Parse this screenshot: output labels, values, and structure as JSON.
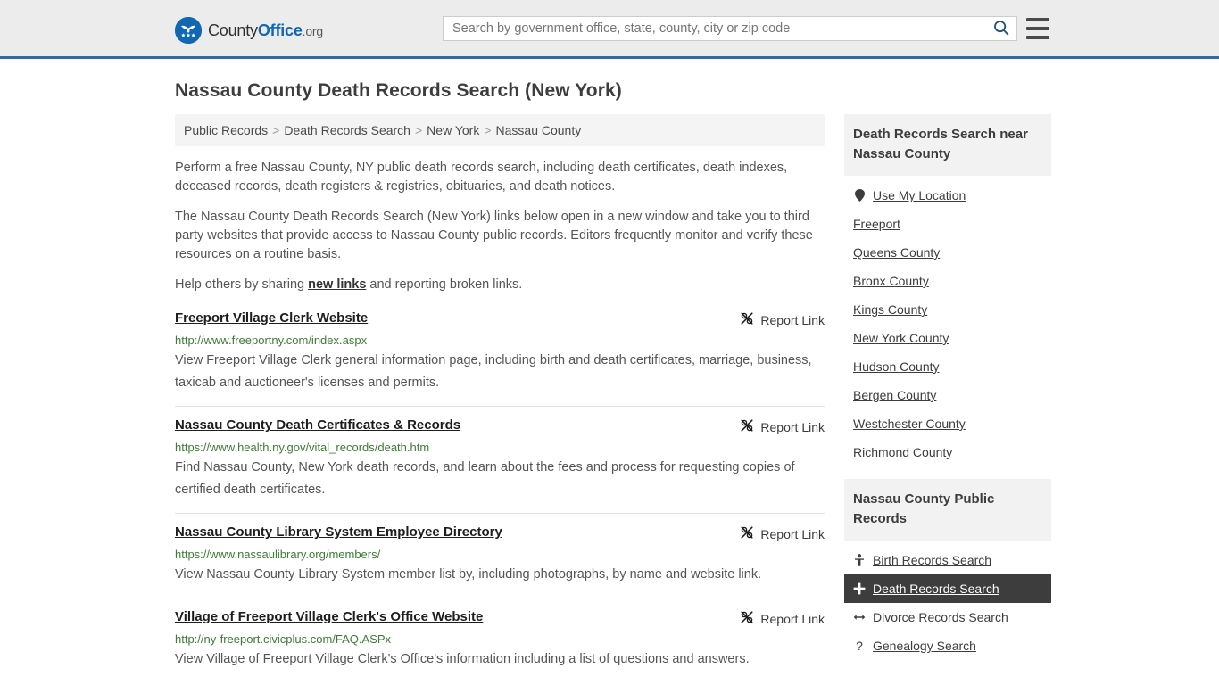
{
  "header": {
    "brand": {
      "logo_icon": "eagle-seal-icon",
      "name_part1": "County",
      "name_part2": "Office",
      "name_part3": ".org"
    },
    "search": {
      "placeholder": "Search by government office, state, county, city or zip code",
      "value": "",
      "search_icon": "search-icon"
    },
    "menu_icon": "hamburger-menu-icon",
    "accent_color": "#35689e"
  },
  "page": {
    "title": "Nassau County Death Records Search (New York)"
  },
  "breadcrumb": {
    "separator": ">",
    "items": [
      {
        "label": "Public Records"
      },
      {
        "label": "Death Records Search"
      },
      {
        "label": "New York"
      },
      {
        "label": "Nassau County"
      }
    ]
  },
  "intro": {
    "paragraph1": "Perform a free Nassau County, NY public death records search, including death certificates, death indexes, deceased records, death registers & registries, obituaries, and death notices.",
    "paragraph2": "The Nassau County Death Records Search (New York) links below open in a new window and take you to third party websites that provide access to Nassau County public records. Editors frequently monitor and verify these resources on a routine basis.",
    "paragraph3_before": "Help others by sharing ",
    "paragraph3_link": "new links",
    "paragraph3_after": " and reporting broken links."
  },
  "results": {
    "report_label": "Report Link",
    "report_icon": "broken-link-icon",
    "items": [
      {
        "title": "Freeport Village Clerk Website",
        "url": "http://www.freeportny.com/index.aspx",
        "description": "View Freeport Village Clerk general information page, including birth and death certificates, marriage, business, taxicab and auctioneer's licenses and permits."
      },
      {
        "title": "Nassau County Death Certificates & Records",
        "url": "https://www.health.ny.gov/vital_records/death.htm",
        "description": "Find Nassau County, New York death records, and learn about the fees and process for requesting copies of certified death certificates."
      },
      {
        "title": "Nassau County Library System Employee Directory",
        "url": "https://www.nassaulibrary.org/members/",
        "description": "View Nassau County Library System member list by, including photographs, by name and website link."
      },
      {
        "title": "Village of Freeport Village Clerk's Office Website",
        "url": "http://ny-freeport.civicplus.com/FAQ.ASPx",
        "description": "View Village of Freeport Village Clerk's Office's information including a list of questions and answers."
      }
    ]
  },
  "sidebar": {
    "nearby": {
      "heading": "Death Records Search near Nassau County",
      "items": [
        {
          "label": "Use My Location",
          "icon": "map-pin-icon",
          "active": false
        },
        {
          "label": "Freeport",
          "icon": "",
          "active": false
        },
        {
          "label": "Queens County",
          "icon": "",
          "active": false
        },
        {
          "label": "Bronx County",
          "icon": "",
          "active": false
        },
        {
          "label": "Kings County",
          "icon": "",
          "active": false
        },
        {
          "label": "New York County",
          "icon": "",
          "active": false
        },
        {
          "label": "Hudson County",
          "icon": "",
          "active": false
        },
        {
          "label": "Bergen County",
          "icon": "",
          "active": false
        },
        {
          "label": "Westchester County",
          "icon": "",
          "active": false
        },
        {
          "label": "Richmond County",
          "icon": "",
          "active": false
        }
      ]
    },
    "public_records": {
      "heading": "Nassau County Public Records",
      "items": [
        {
          "label": "Birth Records Search",
          "icon": "baby-icon",
          "glyph": "Ɣ",
          "active": false
        },
        {
          "label": "Death Records Search",
          "icon": "cross-icon",
          "glyph": "✚",
          "active": true
        },
        {
          "label": "Divorce Records Search",
          "icon": "double-arrow-icon",
          "glyph": "↔",
          "active": false
        },
        {
          "label": "Genealogy Search",
          "icon": "question-mark-icon",
          "glyph": "?",
          "active": false
        }
      ]
    },
    "highlight_color": "#3d3d3d"
  }
}
